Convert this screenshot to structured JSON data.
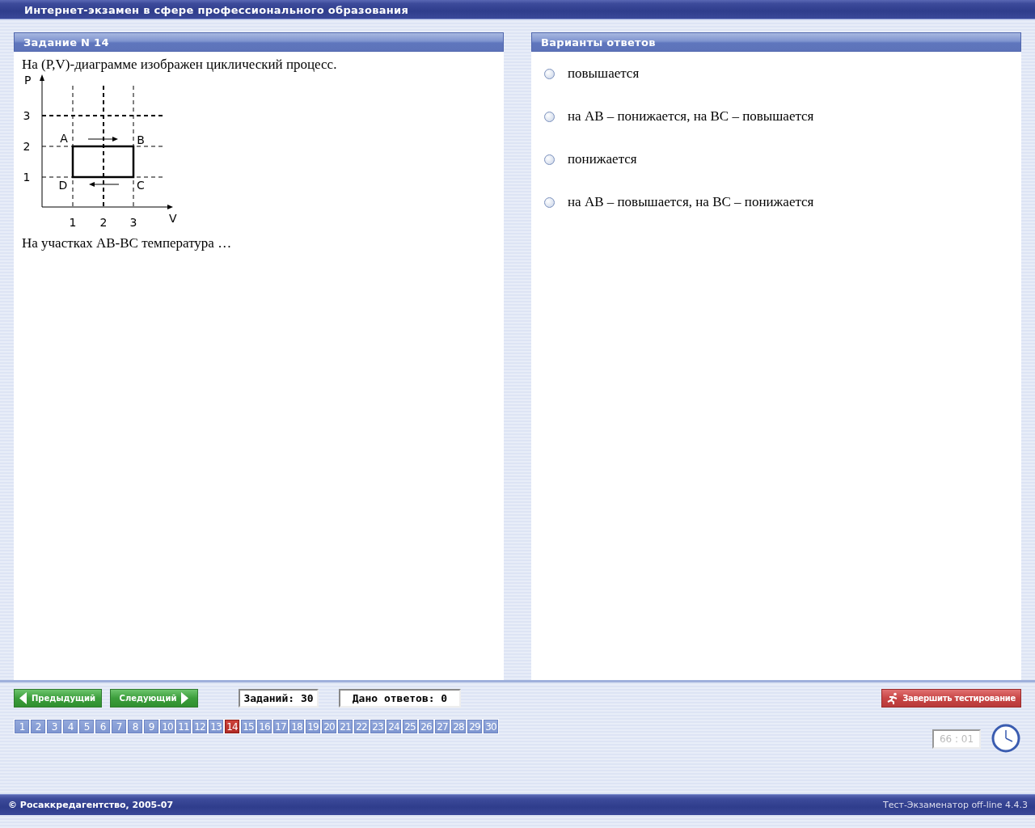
{
  "window": {
    "title": "Интернет-экзамен в сфере профессионального образования"
  },
  "task": {
    "header": "Задание N 14",
    "question": "На (P,V)-диаграмме изображен циклический процесс.",
    "diagram": {
      "y_axis_label": "P",
      "x_axis_label": "V",
      "x_ticks": [
        "1",
        "2",
        "3"
      ],
      "y_ticks": [
        "3",
        "2",
        "1"
      ],
      "points": [
        "A",
        "B",
        "D",
        "C"
      ]
    },
    "prompt": "На участках АВ-ВС температура …"
  },
  "answers": {
    "header": "Варианты ответов",
    "options": [
      {
        "label": "повышается",
        "selected": false
      },
      {
        "label": "на АВ – понижается, на ВС – повышается",
        "selected": false
      },
      {
        "label": "понижается",
        "selected": false
      },
      {
        "label": "на АВ – повышается, на ВС – понижается",
        "selected": false
      }
    ]
  },
  "navigation": {
    "prev_button": "Предыдущий",
    "next_button": "Следующий",
    "tasks_count": "Заданий: 30",
    "answers_count": "Дано ответов: 0",
    "finish_button": "Завершить тестирование",
    "pages": [
      {
        "label": "1",
        "selected": false
      },
      {
        "label": "2",
        "selected": false
      },
      {
        "label": "3",
        "selected": false
      },
      {
        "label": "4",
        "selected": false
      },
      {
        "label": "5",
        "selected": false
      },
      {
        "label": "6",
        "selected": false
      },
      {
        "label": "7",
        "selected": false
      },
      {
        "label": "8",
        "selected": false
      },
      {
        "label": "9",
        "selected": false
      },
      {
        "label": "10",
        "selected": false
      },
      {
        "label": "11",
        "selected": false
      },
      {
        "label": "12",
        "selected": false
      },
      {
        "label": "13",
        "selected": false
      },
      {
        "label": "14",
        "selected": true
      },
      {
        "label": "15",
        "selected": false
      },
      {
        "label": "16",
        "selected": false
      },
      {
        "label": "17",
        "selected": false
      },
      {
        "label": "18",
        "selected": false
      },
      {
        "label": "19",
        "selected": false
      },
      {
        "label": "20",
        "selected": false
      },
      {
        "label": "21",
        "selected": false
      },
      {
        "label": "22",
        "selected": false
      },
      {
        "label": "23",
        "selected": false
      },
      {
        "label": "24",
        "selected": false
      },
      {
        "label": "25",
        "selected": false
      },
      {
        "label": "26",
        "selected": false
      },
      {
        "label": "27",
        "selected": false
      },
      {
        "label": "28",
        "selected": false
      },
      {
        "label": "29",
        "selected": false
      },
      {
        "label": "30",
        "selected": false
      }
    ],
    "timer": "66 : 01"
  },
  "status_bar": {
    "copyright": "© Росаккредагентство, 2005-07",
    "version": "Тест-Экзаменатор off-line 4.4.3"
  }
}
